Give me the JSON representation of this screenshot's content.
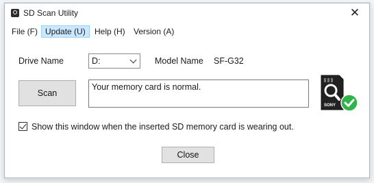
{
  "window": {
    "title": "SD Scan Utility",
    "close_glyph": "✕"
  },
  "menu": [
    {
      "label": "File (F)"
    },
    {
      "label": "Update (U)",
      "active": true
    },
    {
      "label": "Help (H)"
    },
    {
      "label": "Version (A)"
    }
  ],
  "drive": {
    "label": "Drive Name",
    "value": "D:"
  },
  "model": {
    "label": "Model Name",
    "value": "SF-G32"
  },
  "scan": {
    "button_label": "Scan",
    "status_text": "Your memory card is normal."
  },
  "notify": {
    "checked": true,
    "label": "Show this window when the inserted SD memory card is wearing out."
  },
  "footer": {
    "close_label": "Close"
  },
  "card_icon": {
    "name": "sd-card-check-icon",
    "brand_text": "SONY",
    "check_color": "#2fb34a"
  }
}
